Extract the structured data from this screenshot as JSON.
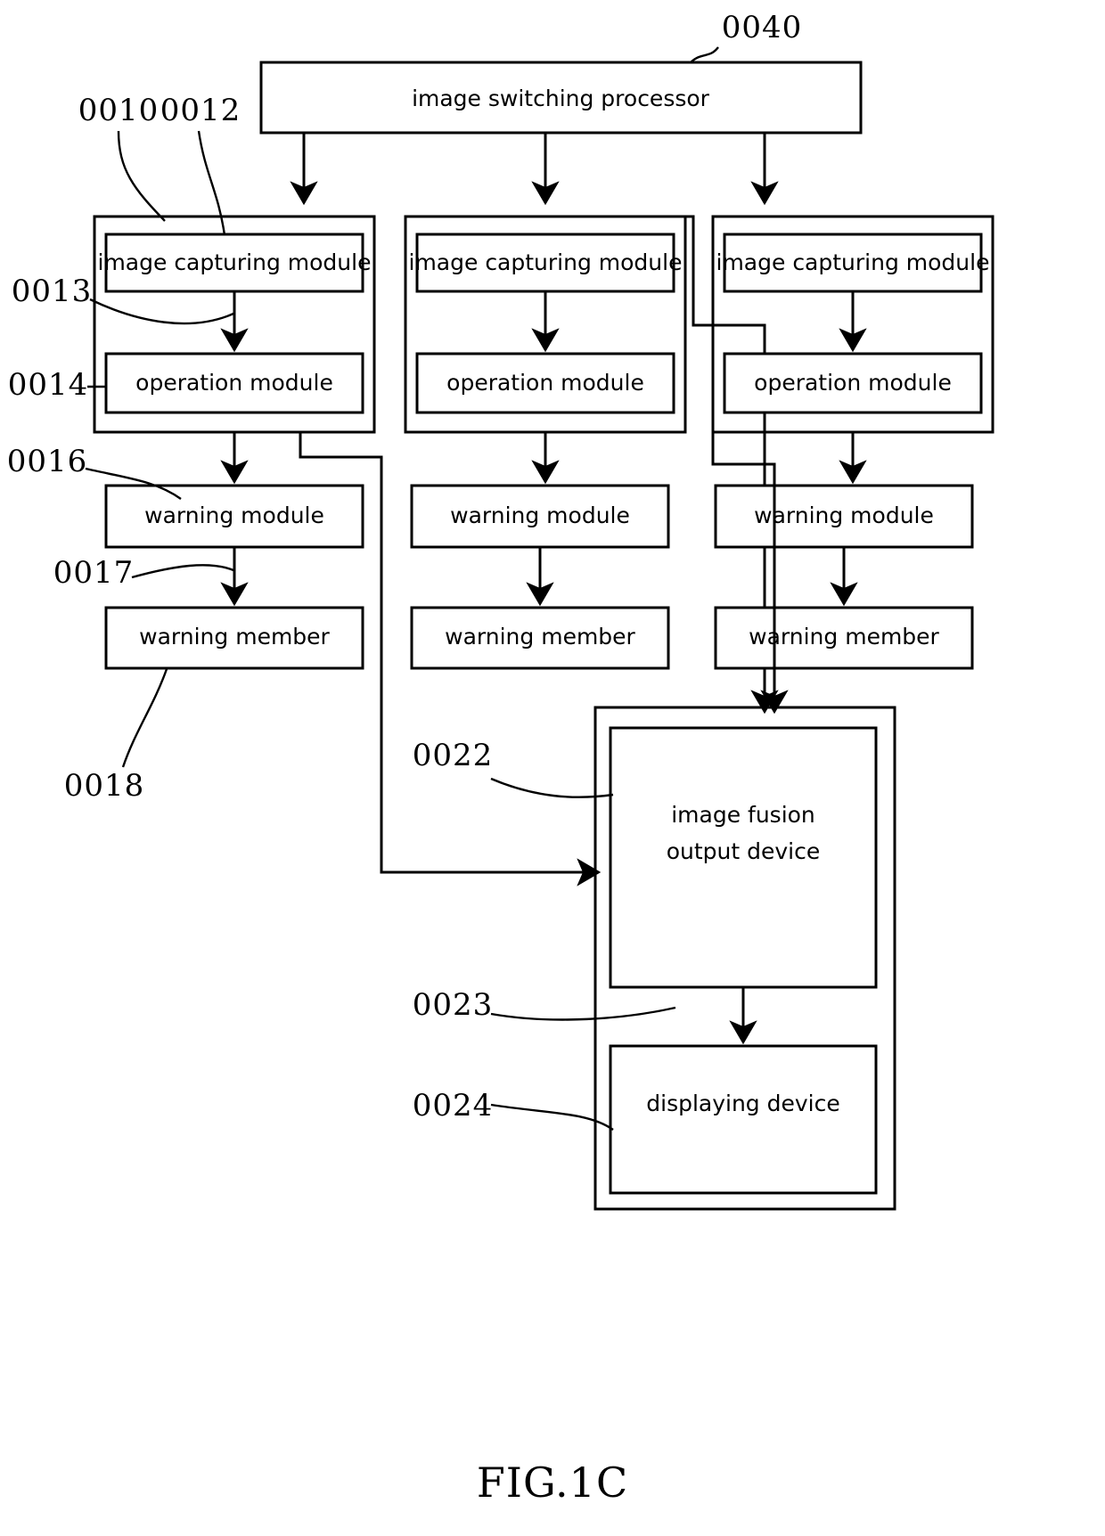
{
  "figure": {
    "caption": "FIG.1C",
    "type": "patent-block-diagram"
  },
  "processor": {
    "label": "image switching processor",
    "ref": "0040"
  },
  "columns": [
    {
      "id": "left",
      "group_ref": "0010",
      "capture_label": "image capturing module",
      "capture_ref": "0012",
      "link_capture_operation_ref": "0013",
      "operation_label": "operation module",
      "operation_ref": "0014",
      "warning_module_label": "warning module",
      "warning_module_ref": "0016",
      "link_warning_member_ref": "0017",
      "warning_member_label": "warning member",
      "warning_member_ref": "0018"
    },
    {
      "id": "middle",
      "group_ref": "",
      "capture_label": "image capturing module",
      "capture_ref": "",
      "link_capture_operation_ref": "",
      "operation_label": "operation module",
      "operation_ref": "",
      "warning_module_label": "warning module",
      "warning_module_ref": "",
      "link_warning_member_ref": "",
      "warning_member_label": "warning member",
      "warning_member_ref": ""
    },
    {
      "id": "right",
      "group_ref": "",
      "capture_label": "image capturing module",
      "capture_ref": "",
      "link_capture_operation_ref": "",
      "operation_label": "operation module",
      "operation_ref": "",
      "warning_module_label": "warning module",
      "warning_module_ref": "",
      "link_warning_member_ref": "",
      "warning_member_label": "warning member",
      "warning_member_ref": ""
    }
  ],
  "output_group": {
    "fusion_label_line1": "image fusion",
    "fusion_label_line2": "output device",
    "fusion_ref": "0022",
    "link_fusion_display_ref": "0023",
    "display_label": "displaying device",
    "display_ref": "0024"
  },
  "colors": {
    "stroke": "#000000",
    "background": "#ffffff"
  }
}
